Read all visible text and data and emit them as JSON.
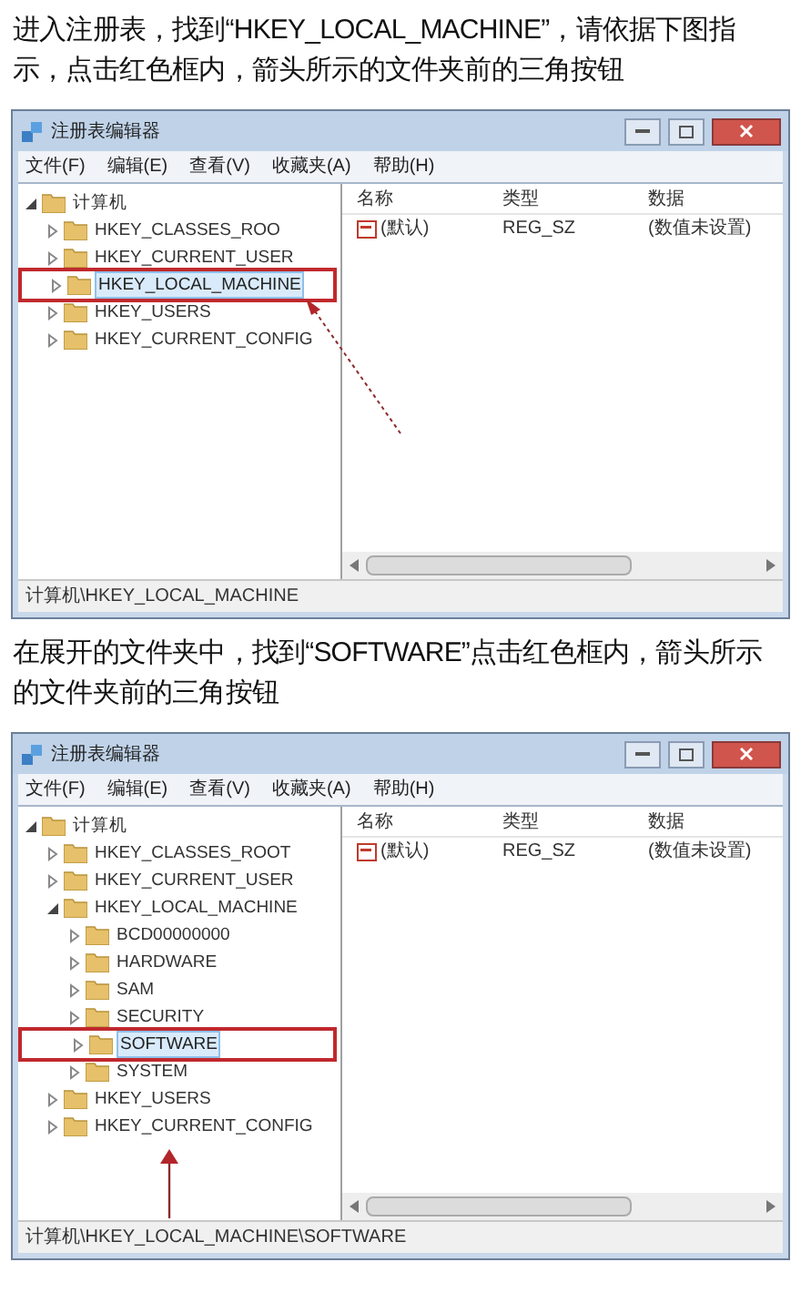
{
  "steps": [
    {
      "instruction": "进入注册表，找到“HKEY_LOCAL_MACHINE”，请依据下图指示，点击红色框内，箭头所示的文件夹前的三角按钮",
      "window": {
        "title": "注册表编辑器",
        "menu": [
          "文件(F)",
          "编辑(E)",
          "查看(V)",
          "收藏夹(A)",
          "帮助(H)"
        ],
        "tree": [
          {
            "label": "计算机",
            "expanded": true,
            "selected": false,
            "highlighted": false,
            "children": [
              {
                "label": "HKEY_CLASSES_ROO",
                "expanded": false,
                "selected": false,
                "highlighted": false
              },
              {
                "label": "HKEY_CURRENT_USER",
                "expanded": false,
                "selected": false,
                "highlighted": false
              },
              {
                "label": "HKEY_LOCAL_MACHINE",
                "expanded": false,
                "selected": true,
                "highlighted": true
              },
              {
                "label": "HKEY_USERS",
                "expanded": false,
                "selected": false,
                "highlighted": false
              },
              {
                "label": "HKEY_CURRENT_CONFIG",
                "expanded": false,
                "selected": false,
                "highlighted": false
              }
            ]
          }
        ],
        "columns": [
          "名称",
          "类型",
          "数据"
        ],
        "values": [
          {
            "name": "(默认)",
            "type": "REG_SZ",
            "data": "(数值未设置)"
          }
        ],
        "status": "计算机\\HKEY_LOCAL_MACHINE"
      }
    },
    {
      "instruction": "在展开的文件夹中，找到“SOFTWARE”点击红色框内，箭头所示的文件夹前的三角按钮",
      "window": {
        "title": "注册表编辑器",
        "menu": [
          "文件(F)",
          "编辑(E)",
          "查看(V)",
          "收藏夹(A)",
          "帮助(H)"
        ],
        "tree": [
          {
            "label": "计算机",
            "expanded": true,
            "selected": false,
            "highlighted": false,
            "children": [
              {
                "label": "HKEY_CLASSES_ROOT",
                "expanded": false,
                "selected": false,
                "highlighted": false
              },
              {
                "label": "HKEY_CURRENT_USER",
                "expanded": false,
                "selected": false,
                "highlighted": false
              },
              {
                "label": "HKEY_LOCAL_MACHINE",
                "expanded": true,
                "selected": false,
                "highlighted": false,
                "children": [
                  {
                    "label": "BCD00000000",
                    "expanded": false,
                    "selected": false,
                    "highlighted": false
                  },
                  {
                    "label": "HARDWARE",
                    "expanded": false,
                    "selected": false,
                    "highlighted": false
                  },
                  {
                    "label": "SAM",
                    "expanded": false,
                    "selected": false,
                    "highlighted": false
                  },
                  {
                    "label": "SECURITY",
                    "expanded": false,
                    "selected": false,
                    "highlighted": false
                  },
                  {
                    "label": "SOFTWARE",
                    "expanded": false,
                    "selected": true,
                    "highlighted": true
                  },
                  {
                    "label": "SYSTEM",
                    "expanded": false,
                    "selected": false,
                    "highlighted": false
                  }
                ]
              },
              {
                "label": "HKEY_USERS",
                "expanded": false,
                "selected": false,
                "highlighted": false
              },
              {
                "label": "HKEY_CURRENT_CONFIG",
                "expanded": false,
                "selected": false,
                "highlighted": false
              }
            ]
          }
        ],
        "columns": [
          "名称",
          "类型",
          "数据"
        ],
        "values": [
          {
            "name": "(默认)",
            "type": "REG_SZ",
            "data": "(数值未设置)"
          }
        ],
        "status": "计算机\\HKEY_LOCAL_MACHINE\\SOFTWARE"
      }
    }
  ]
}
